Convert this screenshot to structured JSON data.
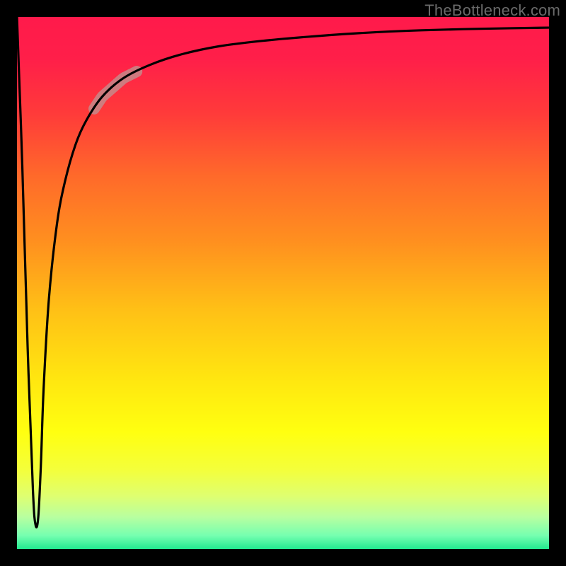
{
  "attribution": "TheBottleneck.com",
  "gradient_stops": [
    {
      "offset": 0.0,
      "color": "#ff1a4b"
    },
    {
      "offset": 0.08,
      "color": "#ff1f49"
    },
    {
      "offset": 0.18,
      "color": "#ff3a3a"
    },
    {
      "offset": 0.3,
      "color": "#ff6a2a"
    },
    {
      "offset": 0.42,
      "color": "#ff8f1f"
    },
    {
      "offset": 0.55,
      "color": "#ffc016"
    },
    {
      "offset": 0.68,
      "color": "#ffe610"
    },
    {
      "offset": 0.78,
      "color": "#ffff10"
    },
    {
      "offset": 0.85,
      "color": "#f4ff3a"
    },
    {
      "offset": 0.9,
      "color": "#dfff70"
    },
    {
      "offset": 0.94,
      "color": "#b8ffa0"
    },
    {
      "offset": 0.975,
      "color": "#75ffb0"
    },
    {
      "offset": 1.0,
      "color": "#22e98f"
    }
  ],
  "highlight_segment": {
    "color": "#c58a8a",
    "width": 16,
    "opacity": 0.85,
    "x_range": [
      0.145,
      0.225
    ]
  },
  "chart_data": {
    "type": "line",
    "title": "",
    "xlabel": "",
    "ylabel": "",
    "xlim": [
      0,
      1
    ],
    "ylim": [
      0,
      1
    ],
    "series": [
      {
        "name": "bottleneck-curve",
        "x": [
          0.0,
          0.01,
          0.02,
          0.03,
          0.035,
          0.04,
          0.045,
          0.05,
          0.06,
          0.075,
          0.09,
          0.11,
          0.13,
          0.16,
          0.2,
          0.25,
          0.31,
          0.38,
          0.46,
          0.55,
          0.65,
          0.76,
          0.88,
          1.0
        ],
        "y": [
          1.0,
          0.72,
          0.38,
          0.11,
          0.045,
          0.06,
          0.16,
          0.3,
          0.47,
          0.61,
          0.69,
          0.76,
          0.805,
          0.85,
          0.885,
          0.91,
          0.93,
          0.945,
          0.955,
          0.963,
          0.97,
          0.975,
          0.978,
          0.98
        ]
      }
    ],
    "annotations": [
      {
        "type": "highlight",
        "x_start": 0.145,
        "x_end": 0.225,
        "note": "thick pink segment on curve"
      }
    ]
  }
}
